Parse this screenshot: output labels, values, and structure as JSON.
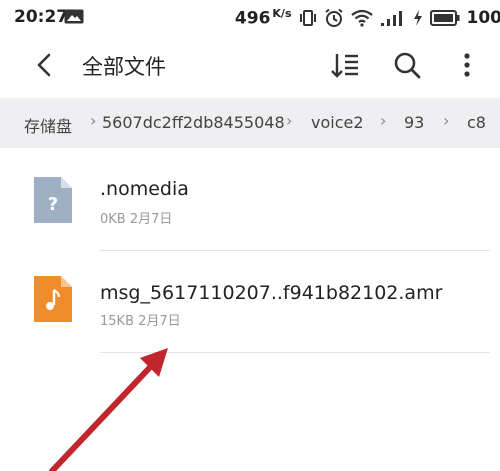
{
  "status_bar": {
    "time": "20:27",
    "net_speed": "496",
    "net_unit": "K/s",
    "battery_text": "100"
  },
  "appbar": {
    "title": "全部文件"
  },
  "breadcrumb": {
    "items": [
      "存储盘",
      "5607dc2ff2db8455048",
      "voice2",
      "93",
      "c8"
    ]
  },
  "files": [
    {
      "name": ".nomedia",
      "size": "0KB",
      "date": "2月7日",
      "icon": "unknown-file-icon",
      "icon_color": "#9fb0c4"
    },
    {
      "name": "msg_5617110207..f941b82102.amr",
      "size": "15KB",
      "date": "2月7日",
      "icon": "audio-file-icon",
      "icon_color": "#f08c2a"
    }
  ],
  "annotation": {
    "arrow_color": "#c0262b"
  }
}
